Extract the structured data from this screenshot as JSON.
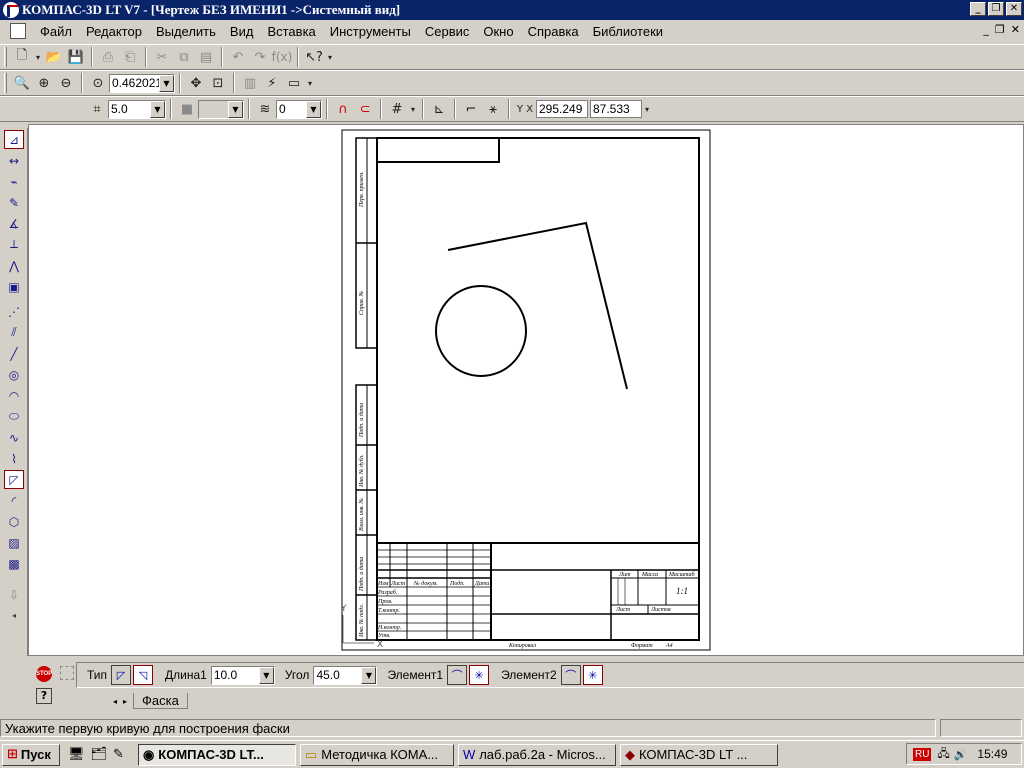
{
  "window": {
    "title": "КОМПАС-3D LT V7 - [Чертеж БЕЗ ИМЕНИ1 ->Системный вид]"
  },
  "menubar": {
    "items": [
      "Файл",
      "Редактор",
      "Выделить",
      "Вид",
      "Вставка",
      "Инструменты",
      "Сервис",
      "Окно",
      "Справка",
      "Библиотеки"
    ]
  },
  "view_toolbar": {
    "zoom_value": "0.462021"
  },
  "draw_toolbar": {
    "step_value": "5.0",
    "layer_value": "0",
    "coord_x": "295.249",
    "coord_y": "87.533"
  },
  "drawing": {
    "stamp_labels": {
      "format": "Формат",
      "format_value": "А4",
      "copied": "Копировал",
      "lit": "Лит",
      "mass": "Масса",
      "scale": "Масштаб",
      "scale_value": "1:1",
      "sheet": "Лист",
      "sheets": "Листов",
      "izm": "Изм",
      "list_col": "Лист",
      "doc_no": "№ докум.",
      "sign": "Подп.",
      "date": "Дата",
      "razrab": "Разраб.",
      "prov": "Пров.",
      "tkontr": "Т.контр.",
      "nkontr": "Н.контр.",
      "utv": "Утв."
    },
    "side_labels": [
      "Перв. примен.",
      "Справ. №",
      "Подп. и дата",
      "Инв. № дубл.",
      "Взам. инв. №",
      "Подп. и дата",
      "Инв. № подл."
    ]
  },
  "property_panel": {
    "type_label": "Тип",
    "length_label": "Длина1",
    "length_value": "10.0",
    "angle_label": "Угол",
    "angle_value": "45.0",
    "element1_label": "Элемент1",
    "element2_label": "Элемент2",
    "tab_label": "Фаска"
  },
  "status": {
    "message": "Укажите первую кривую для построения фаски"
  },
  "taskbar": {
    "start_label": "Пуск",
    "tasks": [
      "КОМПАС-3D LT...",
      "Методичка КОМА...",
      "лаб.раб.2а - Micros...",
      "КОМПАС-3D LT ..."
    ],
    "lang": "RU",
    "clock": "15:49"
  },
  "icons": {
    "stop_icon": "stop-icon",
    "help_icon": "help-icon"
  }
}
